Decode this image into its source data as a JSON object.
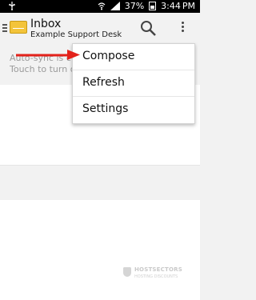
{
  "status_bar": {
    "battery": "37%",
    "time": "3:44",
    "ampm": "PM"
  },
  "action_bar": {
    "title": "Inbox",
    "subtitle": "Example Support Desk"
  },
  "sync_message": {
    "line1": "Auto-sync is c",
    "line2": "Touch to turn o"
  },
  "menu": {
    "items": [
      {
        "label": "Compose"
      },
      {
        "label": "Refresh"
      },
      {
        "label": "Settings"
      }
    ]
  },
  "watermark": {
    "line1": "HOSTSECTORS",
    "line2": "HOSTING DISCOUNTS"
  },
  "colors": {
    "annotation_arrow": "#e3221b",
    "app_icon": "#f3c43a"
  },
  "icons": [
    "usb-icon",
    "wifi-icon",
    "signal-icon",
    "battery-icon",
    "search-icon",
    "overflow-menu-icon",
    "drawer-icon",
    "app-icon"
  ]
}
